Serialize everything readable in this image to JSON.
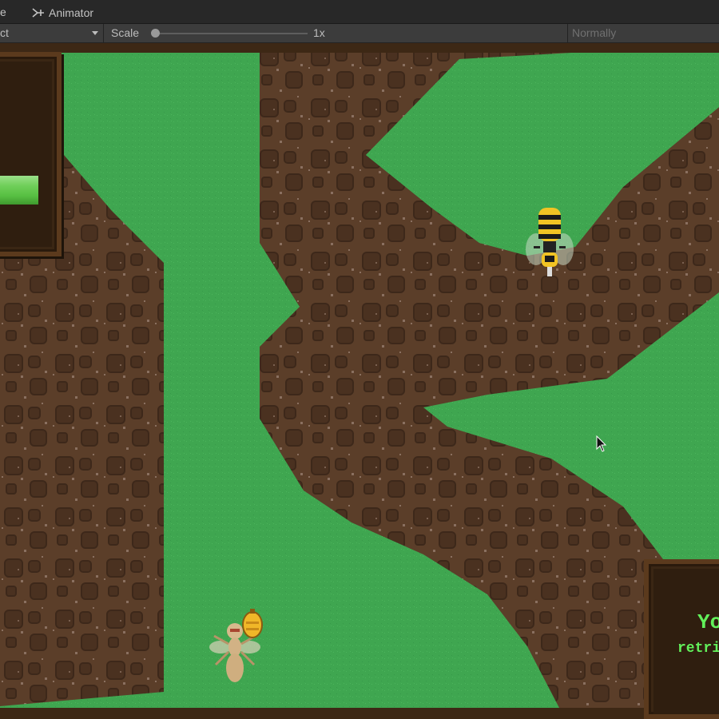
{
  "editor": {
    "tab_fragment": "e",
    "tab_animator": "Animator",
    "aspect_value": "ct",
    "scale_label": "Scale",
    "scale_value": "1x",
    "scale_fraction": 0,
    "play_mode_label": "Normally"
  },
  "game": {
    "health_bar_fill": 1.0,
    "health_color": "#5fcf4a",
    "grass_color": "#3fa650",
    "dirt_color": "#5b3e29",
    "message_line1": "Yo",
    "message_line2": "retri",
    "message_color": "#62f05a",
    "entities": [
      {
        "name": "wasp-enemy",
        "icon": "wasp-icon"
      },
      {
        "name": "ant-player-carrying-honey",
        "icon": "ant-icon"
      },
      {
        "name": "mouse-cursor",
        "icon": "arrow-cursor-icon"
      }
    ]
  }
}
